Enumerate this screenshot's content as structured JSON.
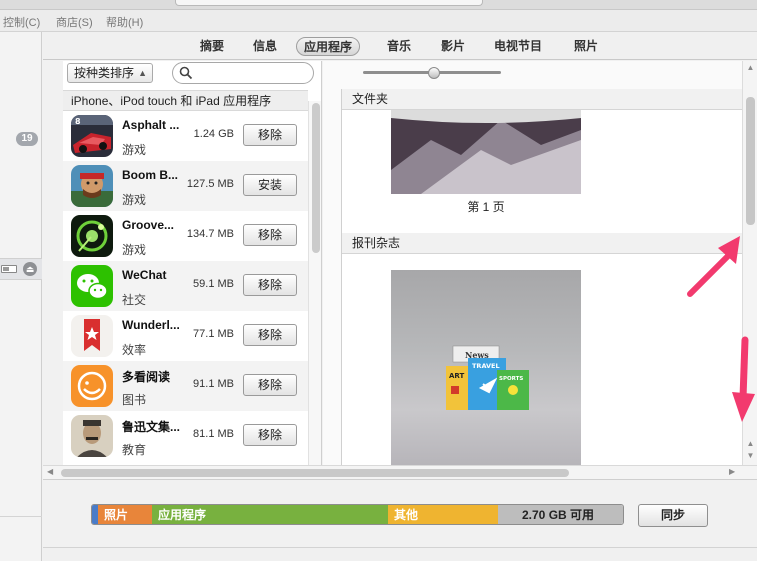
{
  "menubar": {
    "items": [
      "控制(C)",
      "商店(S)",
      "帮助(H)"
    ]
  },
  "sidebar": {
    "badge_count": "19"
  },
  "tabs": [
    "摘要",
    "信息",
    "应用程序",
    "音乐",
    "影片",
    "电视节目",
    "照片"
  ],
  "active_tab": "应用程序",
  "apps_panel": {
    "sort_label": "按种类排序",
    "search_placeholder": "",
    "section_header": "iPhone、iPod touch 和 iPad 应用程序",
    "apps": [
      {
        "name": "Asphalt ...",
        "category": "游戏",
        "size": "1.24 GB",
        "action": "移除"
      },
      {
        "name": "Boom B...",
        "category": "游戏",
        "size": "127.5 MB",
        "action": "安装"
      },
      {
        "name": "Groove...",
        "category": "游戏",
        "size": "134.7 MB",
        "action": "移除"
      },
      {
        "name": "WeChat",
        "category": "社交",
        "size": "59.1 MB",
        "action": "移除"
      },
      {
        "name": "Wunderl...",
        "category": "效率",
        "size": "77.1 MB",
        "action": "移除"
      },
      {
        "name": "多看阅读",
        "category": "图书",
        "size": "91.1 MB",
        "action": "移除"
      },
      {
        "name": "鲁迅文集...",
        "category": "教育",
        "size": "81.1 MB",
        "action": "移除"
      }
    ]
  },
  "pages_panel": {
    "folder_header": "文件夹",
    "page_label": "第 1 页",
    "newsstand_header": "报刊杂志",
    "newsstand_icon_texts": [
      "News",
      "TRAVEL",
      "ART",
      "SPORTS"
    ]
  },
  "storage": {
    "segments": [
      {
        "label": "照片",
        "color": "#e8853a"
      },
      {
        "label": "应用程序",
        "color": "#78b13f"
      },
      {
        "label": "其他",
        "color": "#efb430"
      }
    ],
    "free_label": "2.70 GB 可用",
    "free_color": "#bdbdbd"
  },
  "sync_button": "同步",
  "annotation_color": "#f23a6e"
}
